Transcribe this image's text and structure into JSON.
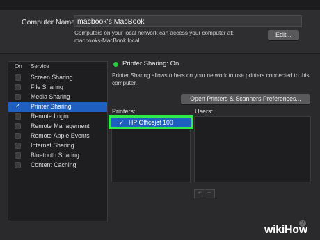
{
  "header": {
    "computer_name_label": "Computer Name:",
    "computer_name_value": "macbook's MacBook",
    "description_line1": "Computers on your local network can access your computer at:",
    "description_line2": "macbooks-MacBook.local",
    "edit_label": "Edit..."
  },
  "services": {
    "col_on": "On",
    "col_service": "Service",
    "items": [
      {
        "label": "Screen Sharing",
        "checked": false,
        "selected": false
      },
      {
        "label": "File Sharing",
        "checked": false,
        "selected": false
      },
      {
        "label": "Media Sharing",
        "checked": false,
        "selected": false
      },
      {
        "label": "Printer Sharing",
        "checked": true,
        "selected": true
      },
      {
        "label": "Remote Login",
        "checked": false,
        "selected": false
      },
      {
        "label": "Remote Management",
        "checked": false,
        "selected": false
      },
      {
        "label": "Remote Apple Events",
        "checked": false,
        "selected": false
      },
      {
        "label": "Internet Sharing",
        "checked": false,
        "selected": false
      },
      {
        "label": "Bluetooth Sharing",
        "checked": false,
        "selected": false
      },
      {
        "label": "Content Caching",
        "checked": false,
        "selected": false
      }
    ]
  },
  "detail": {
    "status": "Printer Sharing: On",
    "status_color": "#27c93f",
    "description": "Printer Sharing allows others on your network to use printers connected to this computer.",
    "open_prefs_label": "Open Printers & Scanners Preferences...",
    "printers_label": "Printers:",
    "users_label": "Users:",
    "printers": [
      {
        "label": "HP Officejet 100",
        "checked": true
      }
    ],
    "add_label": "+",
    "remove_label": "−"
  },
  "watermark": {
    "wiki": "wiki",
    "how": "How"
  },
  "help_label": "?"
}
